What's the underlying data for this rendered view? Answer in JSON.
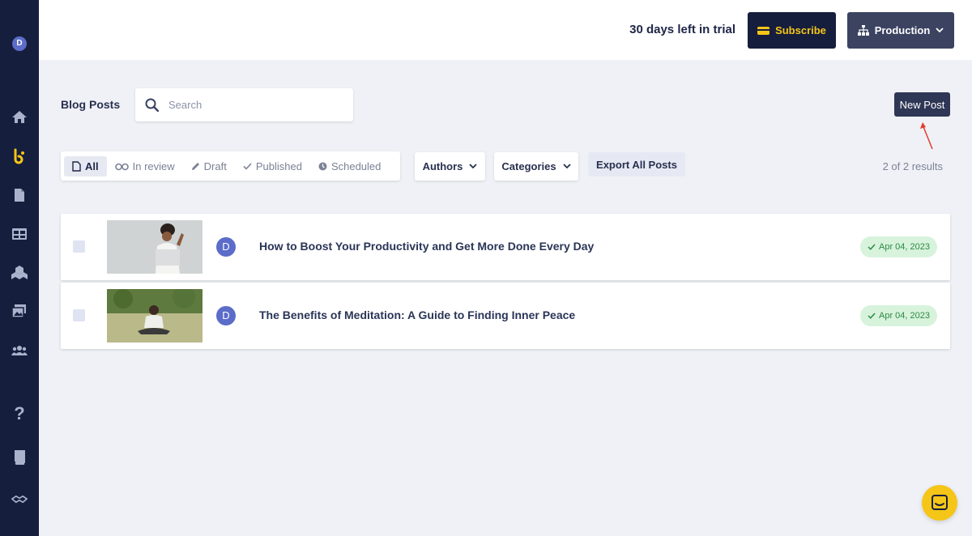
{
  "sidebar": {
    "avatar_initial": "D",
    "items": [
      {
        "icon": "home-icon"
      },
      {
        "icon": "blog-logo-icon"
      },
      {
        "icon": "document-icon"
      },
      {
        "icon": "layout-icon"
      },
      {
        "icon": "components-icon"
      },
      {
        "icon": "media-icon"
      },
      {
        "icon": "team-icon"
      }
    ],
    "help_label": "?",
    "bottom_items": [
      {
        "icon": "book-icon"
      },
      {
        "icon": "handshake-icon"
      }
    ]
  },
  "topbar": {
    "trial_text": "30 days left in trial",
    "subscribe_label": "Subscribe",
    "environment_label": "Production",
    "accent_color": "#f5c518"
  },
  "header": {
    "title": "Blog Posts",
    "search_placeholder": "Search",
    "new_post_label": "New Post"
  },
  "filters": {
    "status_tabs": [
      {
        "label": "All",
        "icon": "document-icon",
        "active": true
      },
      {
        "label": "In review",
        "icon": "glasses-icon",
        "active": false
      },
      {
        "label": "Draft",
        "icon": "pencil-icon",
        "active": false
      },
      {
        "label": "Published",
        "icon": "check-icon",
        "active": false
      },
      {
        "label": "Scheduled",
        "icon": "clock-icon",
        "active": false
      }
    ],
    "authors_label": "Authors",
    "categories_label": "Categories",
    "export_label": "Export All Posts",
    "results_text": "2 of 2 results"
  },
  "posts": [
    {
      "author_initial": "D",
      "title": "How to Boost Your Productivity and Get More Done Every Day",
      "date": "Apr 04, 2023"
    },
    {
      "author_initial": "D",
      "title": "The Benefits of Meditation: A Guide to Finding Inner Peace",
      "date": "Apr 04, 2023"
    }
  ]
}
